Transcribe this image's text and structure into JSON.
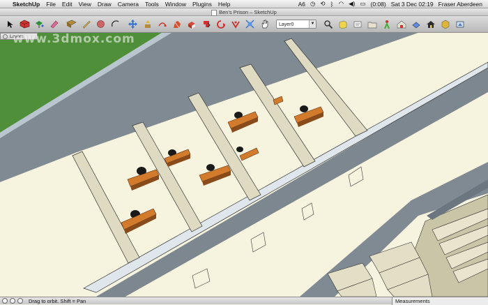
{
  "menubar": {
    "app_name": "SketchUp",
    "menus": [
      "File",
      "Edit",
      "View",
      "Draw",
      "Camera",
      "Tools",
      "Window",
      "Plugins",
      "Help"
    ],
    "adobe_badge": "6",
    "battery": "(0:08)",
    "datetime": "Sat 3 Dec  02:19",
    "user": "Fraser Aberdeen"
  },
  "window": {
    "title": "Ben's Prison – SketchUp"
  },
  "toolbar": {
    "layer_value": "Layer0"
  },
  "layers_panel": {
    "title": "Layers"
  },
  "watermark": "www.3dmox.com",
  "statusbar": {
    "hint": "Drag to orbit.  Shift = Pan",
    "measurements_label": "Measurements"
  },
  "colors": {
    "grass": "#4f8f3a",
    "road": "#7f8a92",
    "floor": "#f6f3df",
    "wall_top": "#dde4ea",
    "wall_side": "#7d8790",
    "partition": "#dfdac2",
    "desk": "#d27b2c",
    "chair": "#1a1a1a"
  }
}
